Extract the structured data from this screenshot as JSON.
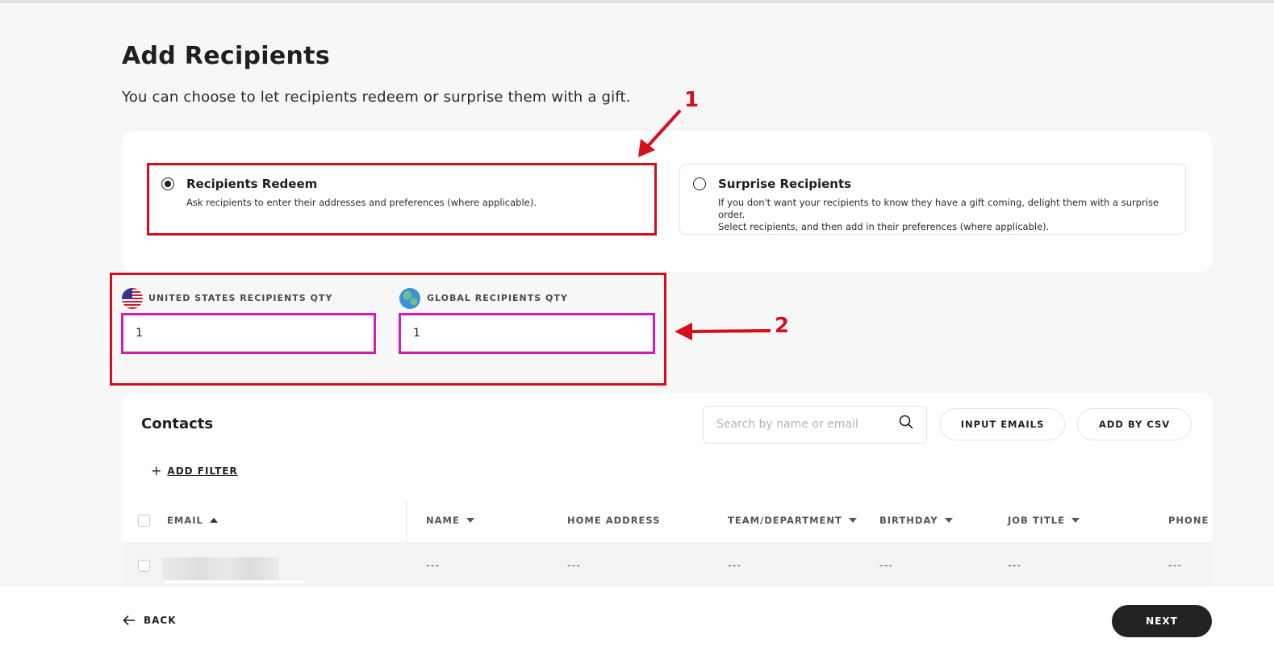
{
  "page": {
    "title": "Add Recipients",
    "subtitle": "You can choose to let recipients redeem or surprise them with a gift."
  },
  "options": {
    "redeem": {
      "title": "Recipients Redeem",
      "description": "Ask recipients to enter their addresses and preferences (where applicable).",
      "selected": true
    },
    "surprise": {
      "title": "Surprise Recipients",
      "description_line1": "If you don't want your recipients to know they have a gift coming, delight them with a surprise order.",
      "description_line2": "Select recipients, and then add in their preferences (where applicable).",
      "selected": false
    }
  },
  "quantities": {
    "us": {
      "label": "UNITED STATES RECIPIENTS QTY",
      "value": "1",
      "icon": "us-flag-icon"
    },
    "global": {
      "label": "GLOBAL RECIPIENTS QTY",
      "value": "1",
      "icon": "globe-icon"
    }
  },
  "annotations": {
    "marker1": "1",
    "marker2": "2",
    "red": "#d40f1b",
    "magenta": "#d21bbf"
  },
  "contacts": {
    "title": "Contacts",
    "search_placeholder": "Search by name or email",
    "input_emails_label": "INPUT EMAILS",
    "add_csv_label": "ADD BY CSV",
    "add_filter_label": "ADD FILTER",
    "columns": {
      "email": "EMAIL",
      "name": "NAME",
      "home_address": "HOME ADDRESS",
      "team": "TEAM/DEPARTMENT",
      "birthday": "BIRTHDAY",
      "job_title": "JOB TITLE",
      "phone": "PHONE"
    },
    "row": {
      "name": "---",
      "home_address": "---",
      "team": "---",
      "birthday": "---",
      "job_title": "---",
      "phone": "---"
    }
  },
  "footer": {
    "back_label": "BACK",
    "next_label": "NEXT"
  }
}
